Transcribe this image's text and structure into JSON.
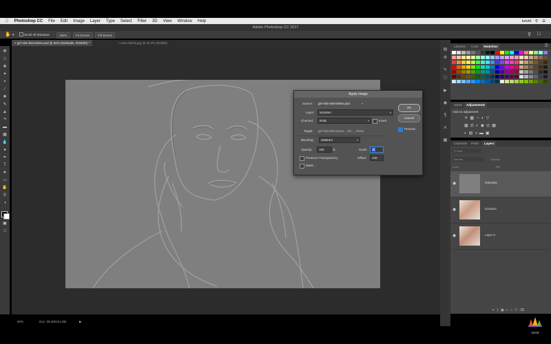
{
  "menubar": {
    "apple": "",
    "items": [
      "Photoshop CC",
      "File",
      "Edit",
      "Image",
      "Layer",
      "Type",
      "Select",
      "Filter",
      "3D",
      "View",
      "Window",
      "Help"
    ],
    "right": [
      "tutvid"
    ]
  },
  "window_title": "Adobe Photoshop CC 2017",
  "options": {
    "scroll_all": "Scroll All Windows",
    "zoom": "100%",
    "fit_screen": "Fit Screen",
    "fill_screen": "Fill Screen"
  },
  "doc_tabs": [
    {
      "label": "girl-skin-blemishes.psd @ 50% (hi/details, RGB/8#) *",
      "active": true
    },
    {
      "label": "man-elderly.jpg @ 33.3% (RGB/8)",
      "active": false
    }
  ],
  "status": {
    "zoom": "50%",
    "doc": "Doc: 35.4M/121.8M"
  },
  "swatches_panel": {
    "tabs": [
      "Libraries",
      "Color",
      "Swatches"
    ],
    "active": "Swatches"
  },
  "adjustments_panel": {
    "tabs": [
      "Styles",
      "Adjustments"
    ],
    "active": "Adjustments",
    "add_label": "Add an adjustment"
  },
  "layers_panel": {
    "tabs": [
      "Channels",
      "Paths",
      "Layers"
    ],
    "active": "Layers",
    "kind": "Kind",
    "blend": "Normal",
    "opacity_label": "Opacity:",
    "lock_label": "Lock:",
    "fill_label": "Fill:",
    "layers": [
      {
        "name": "hi/details",
        "selected": true
      },
      {
        "name": "lo/colors",
        "selected": false
      },
      {
        "name": "Layer 0",
        "selected": false
      }
    ]
  },
  "dialog": {
    "title": "Apply Image",
    "source_label": "Source:",
    "source_value": "girl-skin-blemishes.psd",
    "layer_label": "Layer:",
    "layer_value": "lo/colors",
    "channel_label": "Channel:",
    "channel_value": "RGB",
    "invert_label": "Invert",
    "target_label": "Target:",
    "target_value": "girl-skin-blemishes... (hi/..., RGB)",
    "blending_label": "Blending:",
    "blending_value": "Subtract",
    "opacity_label": "Opacity:",
    "opacity_value": "100",
    "opacity_unit": "%",
    "scale_label": "Scale:",
    "scale_value": "2",
    "preserve_label": "Preserve Transparency",
    "offset_label": "Offset:",
    "offset_value": "128",
    "mask_label": "Mask...",
    "ok_label": "OK",
    "cancel_label": "Cancel",
    "preview_label": "Preview",
    "preview_checked": true,
    "invert_checked": false
  },
  "logo": {
    "text": "tutvid"
  }
}
